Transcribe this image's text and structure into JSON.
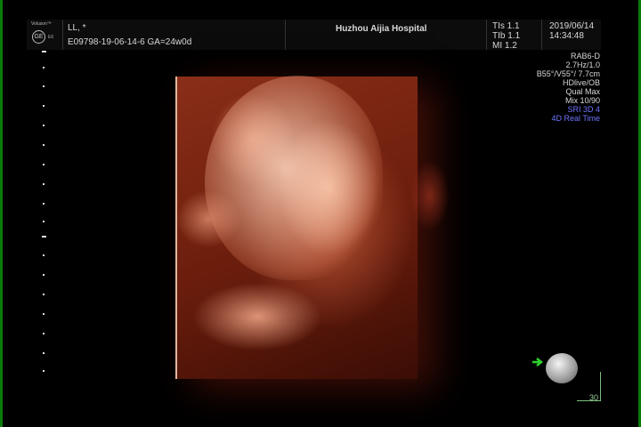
{
  "header": {
    "device_label": "Voluson™",
    "logo_text": "GE",
    "logo_suffix": "E6",
    "patient_name": "LL,  *",
    "exam_line": "E09798-19-06-14-6   GA=24w0d",
    "hospital": "Huzhou Aijia Hospital",
    "tis": "TIs  1.1",
    "tib": "TIb  1.1",
    "mi": "MI  1.2",
    "date": "2019/06/14",
    "time": "14:34:48"
  },
  "params": {
    "probe": "RAB6-D",
    "freq": "2.7Hz/1.0",
    "angle": "B55°/V55°/ 7.7cm",
    "mode": "HDlive/OB",
    "quality": "Qual Max",
    "mix": "Mix 10/90",
    "sri": "SRI 3D 4",
    "realtime": "4D Real Time"
  },
  "scale_label": "30",
  "colors": {
    "accent_green": "#0a7a0a",
    "mode_blue": "#6f74ff",
    "tissue": "#8a2e18"
  }
}
